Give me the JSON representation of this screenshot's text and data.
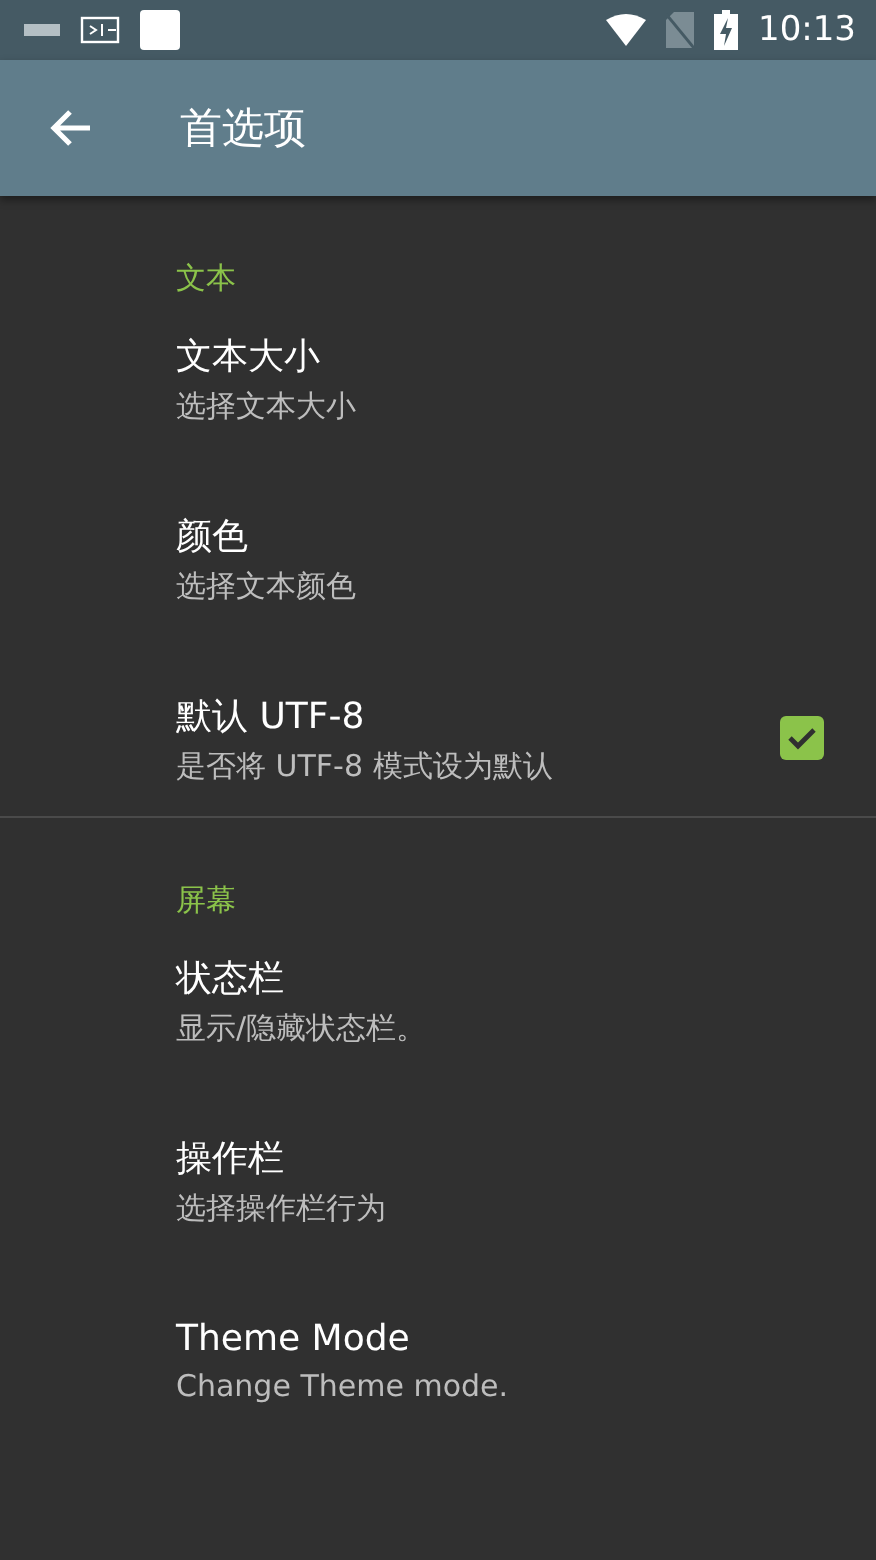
{
  "status_bar": {
    "time": "10:13"
  },
  "app_bar": {
    "title": "首选项"
  },
  "sections": [
    {
      "header": "文本",
      "items": [
        {
          "kind": "plain",
          "title": "文本大小",
          "summary": "选择文本大小"
        },
        {
          "kind": "plain",
          "title": "颜色",
          "summary": "选择文本颜色"
        },
        {
          "kind": "checkbox",
          "title": "默认 UTF-8",
          "summary": "是否将 UTF-8 模式设为默认",
          "checked": true
        }
      ]
    },
    {
      "header": "屏幕",
      "items": [
        {
          "kind": "plain",
          "title": "状态栏",
          "summary": "显示/隐藏状态栏。"
        },
        {
          "kind": "plain",
          "title": "操作栏",
          "summary": "选择操作栏行为"
        },
        {
          "kind": "plain",
          "title": "Theme Mode",
          "summary": "Change Theme mode."
        }
      ]
    }
  ]
}
